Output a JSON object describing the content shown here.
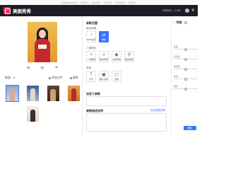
{
  "strip": {
    "items": [
      "编辑帮助在线分享",
      "帮助中心",
      "联系我们",
      "打开网页",
      "有任何疑问",
      "请按我们"
    ]
  },
  "header": {
    "app_name": "美图秀秀",
    "status": "可用积分：2,948",
    "colors": {
      "bar": "#1d1d26",
      "logo": "#ff2e63",
      "crown": "#f5b82e"
    }
  },
  "left": {
    "tools": [
      "rotate-left-icon",
      "rotate-right-icon",
      "crop-icon"
    ],
    "count_label": "数量：6",
    "add_label": "添加文件",
    "delete_label": "删除"
  },
  "middle": {
    "title": "参数设置",
    "section1": "输出设置",
    "opt_a": "RGB设置",
    "opt_b": "重新",
    "section2": "人像美化",
    "opt_c": "一键美颜",
    "opt_d": "肤色调整",
    "opt_e": "头部调整",
    "opt_f": "瘦身塑形",
    "section3": "其他",
    "opt_g": "文字",
    "opt_h": "图片合成",
    "opt_i": "边框",
    "box1_title": "自定义参数",
    "box2_title": "参数描述说明",
    "box2_link": "添加参数说明"
  },
  "right": {
    "title": "明细",
    "items": [
      "亮度",
      "对比度",
      "饱和度",
      "色温",
      "锐化"
    ],
    "levels": [
      0.5,
      0.5,
      0.5,
      0.5,
      0.5
    ],
    "apply_label": "确定"
  },
  "accent": "#3a74ff"
}
